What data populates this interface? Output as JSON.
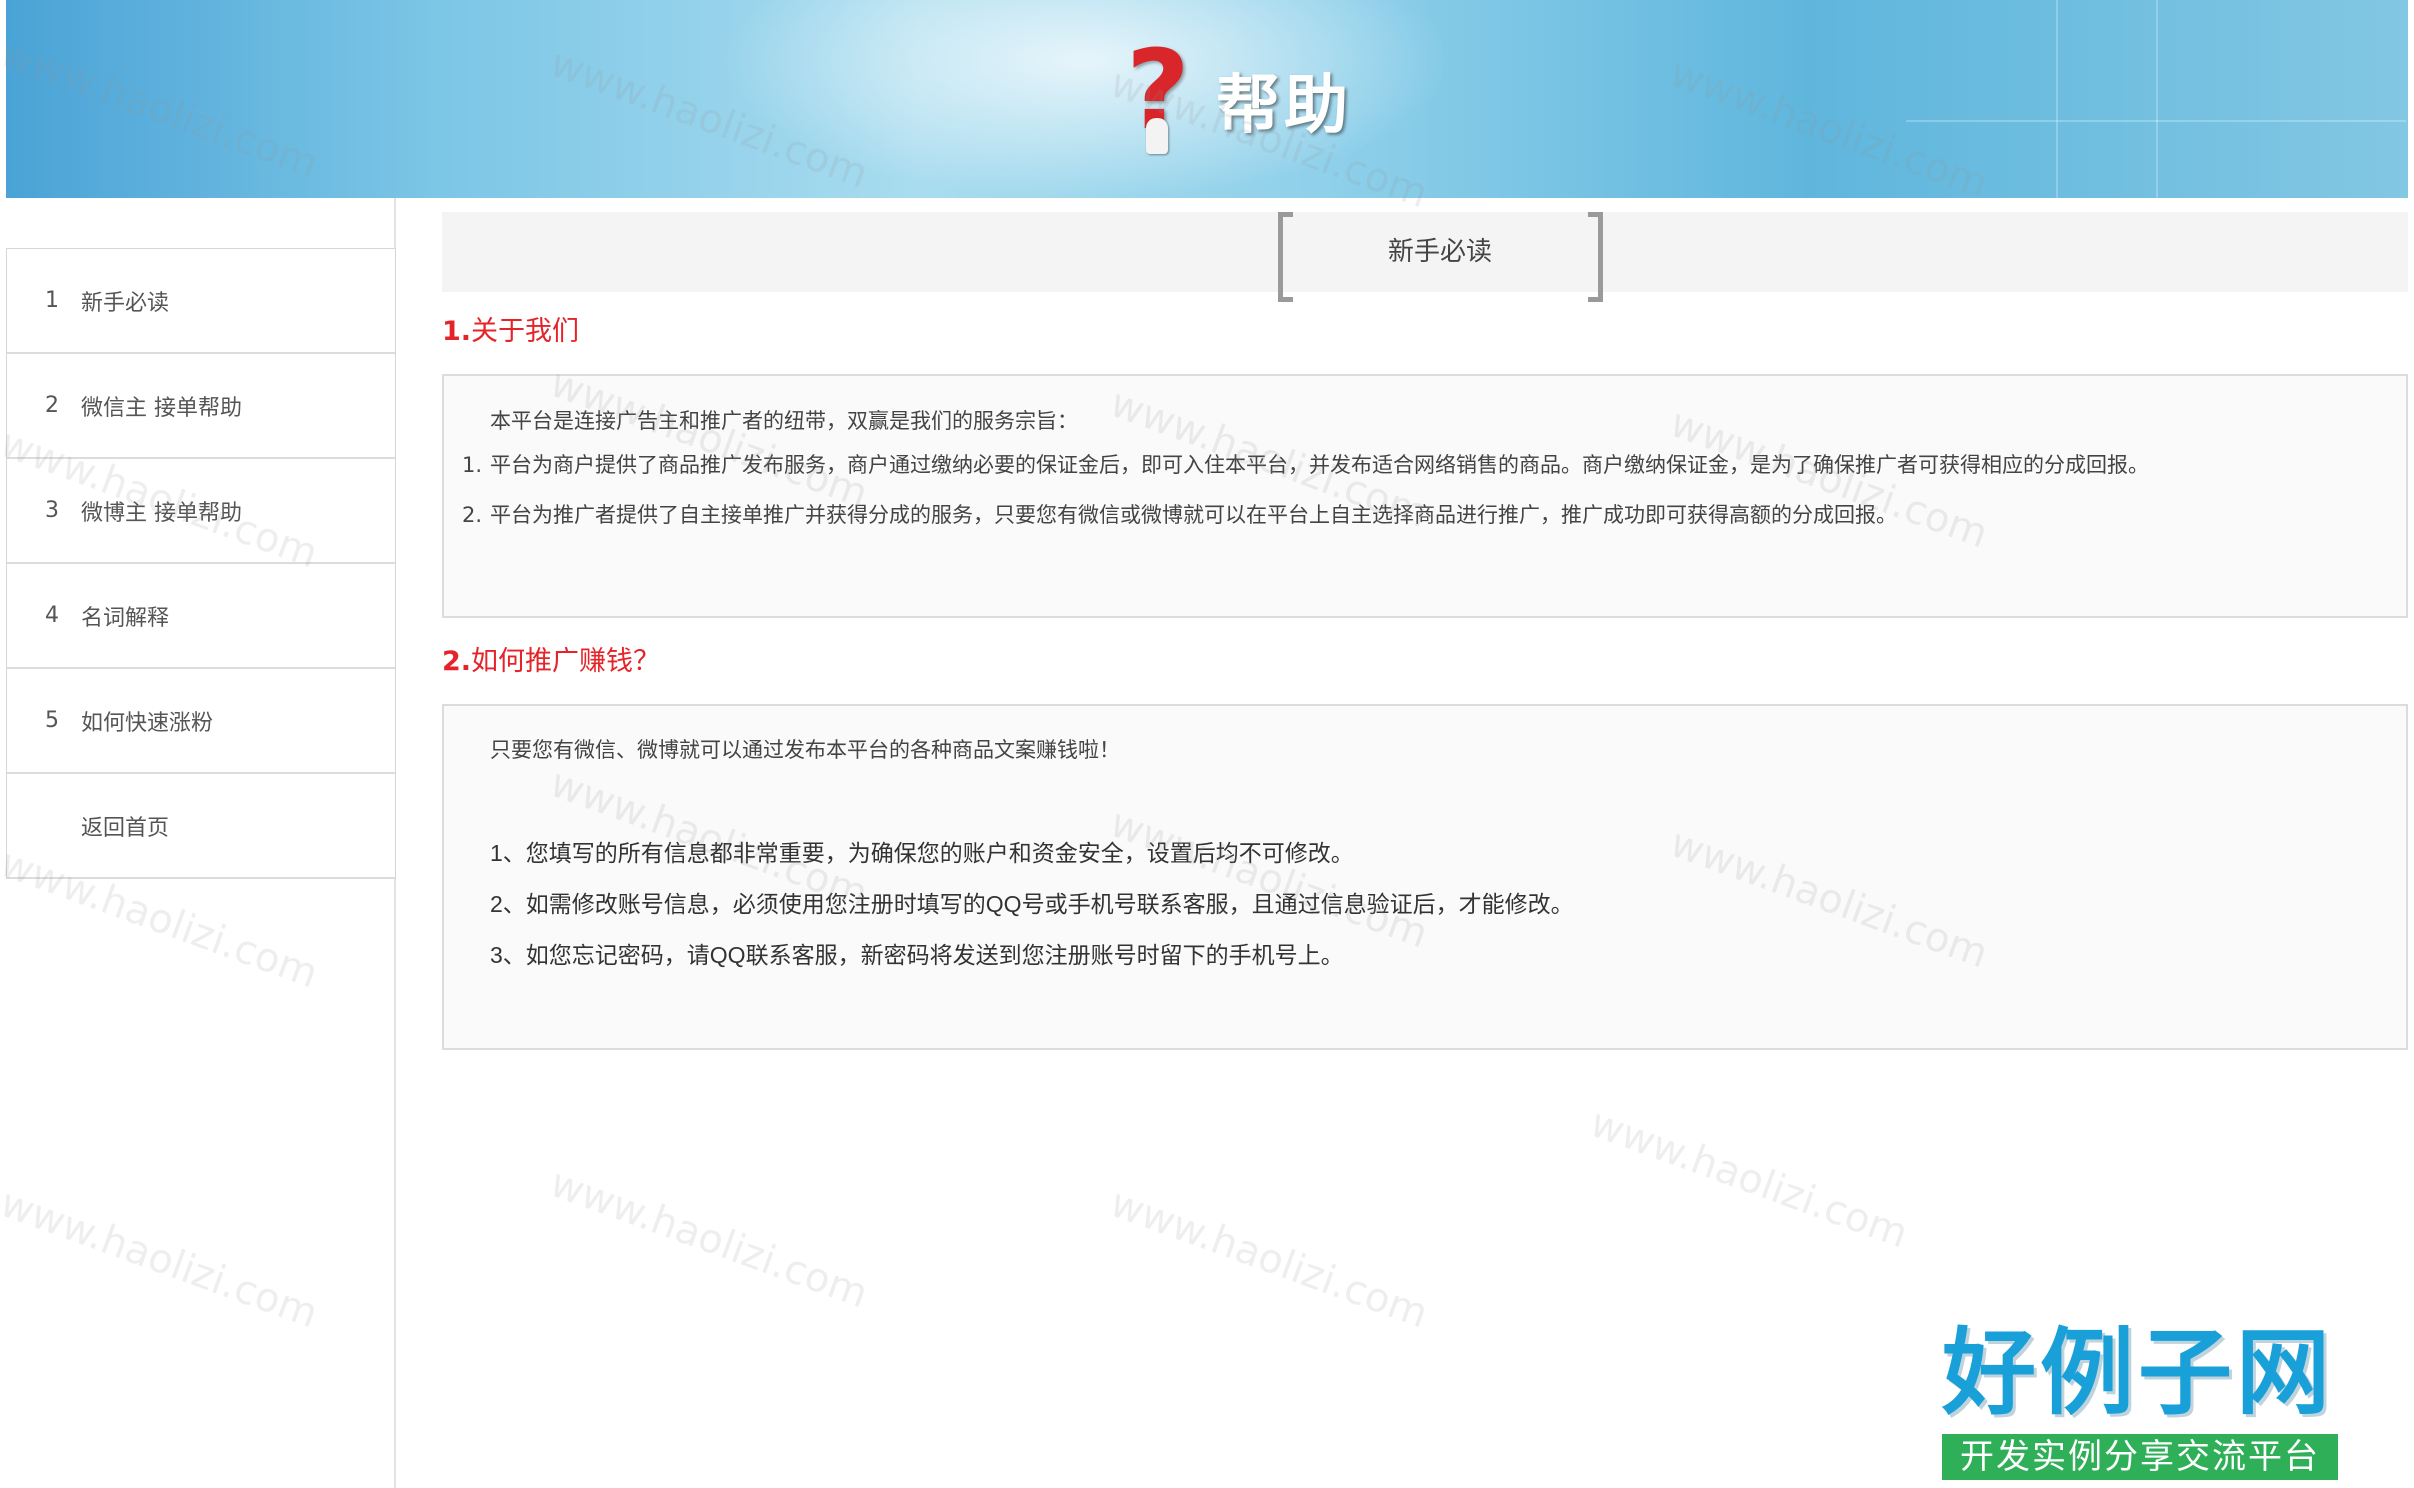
{
  "header": {
    "title": "帮助"
  },
  "sidebar": {
    "items": [
      {
        "num": "1",
        "label": "新手必读"
      },
      {
        "num": "2",
        "label": "微信主 接单帮助"
      },
      {
        "num": "3",
        "label": "微博主 接单帮助"
      },
      {
        "num": "4",
        "label": "名词解释"
      },
      {
        "num": "5",
        "label": "如何快速涨粉"
      },
      {
        "num": "",
        "label": "返回首页"
      }
    ]
  },
  "main": {
    "section_title": "新手必读",
    "q1": {
      "num": "1.",
      "title": "关于我们",
      "intro": "本平台是连接广告主和推广者的纽带，双赢是我们的服务宗旨：",
      "points": [
        {
          "idx": "1.",
          "text": "平台为商户提供了商品推广发布服务，商户通过缴纳必要的保证金后，即可入住本平台，并发布适合网络销售的商品。商户缴纳保证金，是为了确保推广者可获得相应的分成回报。"
        },
        {
          "idx": "2.",
          "text": "平台为推广者提供了自主接单推广并获得分成的服务，只要您有微信或微博就可以在平台上自主选择商品进行推广，推广成功即可获得高额的分成回报。"
        }
      ]
    },
    "q2": {
      "num": "2.",
      "title": "如何推广赚钱？",
      "intro": "只要您有微信、微博就可以通过发布本平台的各种商品文案赚钱啦！",
      "notes": [
        "1、您填写的所有信息都非常重要，为确保您的账户和资金安全，设置后均不可修改。",
        "2、如需修改账号信息，必须使用您注册时填写的QQ号或手机号联系客服，且通过信息验证后，才能修改。",
        "3、如您忘记密码，请QQ联系客服，新密码将发送到您注册账号时留下的手机号上。"
      ]
    }
  },
  "watermark": {
    "text": "www.haolizi.com"
  },
  "brand": {
    "name": "好例子网",
    "slogan": "开发实例分享交流平台"
  }
}
